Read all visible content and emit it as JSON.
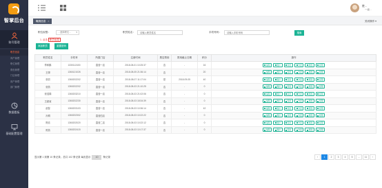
{
  "sidebar": {
    "logo_text": "智掌后台",
    "groups": [
      {
        "label": "账号管理",
        "icon": "user-icon",
        "active": true
      },
      {
        "label": "数据看板",
        "icon": "chart-icon",
        "active": false
      },
      {
        "label": "基础配置管理",
        "icon": "monitor-icon",
        "active": false
      }
    ],
    "sub_items": [
      "职员信息",
      "商户管理",
      "职位管理",
      "角色管理",
      "门店管理",
      "用户管理",
      "部门管理"
    ],
    "current_sub_index": 0
  },
  "topbar": {
    "user_name": "姓...",
    "user_role": "一级...",
    "menu_icon": "hamburger-icon",
    "grid_icon": "grid-icon"
  },
  "tabs": {
    "active_tab": "職員信息",
    "active_tab_close": "×",
    "close_ops": "关闭操作 ▾"
  },
  "filter": {
    "position_label": "职位权限：",
    "position_value": "- 选择职位 -",
    "name_label": "职员姓名：",
    "name_placeholder": "请输入职员姓名",
    "phone_label": "手机号码：",
    "phone_placeholder": "请输入手机号码",
    "search_button": "搜索",
    "hint_prefix": "1. 点击",
    "hint_boxed": "职员信息",
    "add_button": "添加职员",
    "reset_button": "重置密码"
  },
  "table": {
    "columns": [
      "职员姓名",
      "手机号",
      "所属门店",
      "注册时间",
      "是否禁用",
      "禁用截止日期",
      "积分",
      "操作"
    ],
    "rows": [
      [
        "李和鹏",
        "1330112400",
        "直营一店",
        "2018-08-01 10:25:37",
        "否",
        "-",
        "16"
      ],
      [
        "王嫦",
        "1360121026",
        "直营一店",
        "2018-08-05 21:36:14",
        "否",
        "-",
        "20"
      ],
      [
        "张初",
        "1360202202",
        "直营一店",
        "2018-08-07 11:17:04",
        "是",
        "2018-09-05",
        "40"
      ],
      [
        "张燕",
        "1360202202",
        "直营一店",
        "2018-08-03 21:10:25",
        "否",
        "-",
        "0"
      ],
      [
        "张浩娟",
        "1360203210",
        "直营一店",
        "2018-08-03 21:02:06",
        "否",
        "-",
        "0"
      ],
      [
        "王超淑",
        "1360202230",
        "直营一店",
        "2018-08-03 18:34:39",
        "否",
        "-",
        "0"
      ],
      [
        "赵智",
        "1360203103",
        "直营一店",
        "2018-08-03 10:36:14",
        "否",
        "-",
        "42"
      ],
      [
        "孙桐",
        "1360202302",
        "直营四店",
        "2018-08-03 10:22:22",
        "否",
        "-",
        "0"
      ],
      [
        "陈绩",
        "1360202020",
        "直营二店",
        "2018-08-03 10:22:12",
        "否",
        "-",
        "0"
      ],
      [
        "陈燕",
        "1360202415",
        "直营一店",
        "2018-08-03 10:17:37",
        "否",
        "-",
        "0"
      ]
    ],
    "ops": [
      "编辑",
      "账户",
      "积分",
      "卡密",
      "修改",
      "权限"
    ]
  },
  "footer": {
    "info_prefix": "显示第 1 到第 10 条记录，总共 102 条记录 每页显示",
    "page_size": "10",
    "info_suffix": "条记录",
    "pages": [
      "‹",
      "1",
      "2",
      "3",
      "4",
      "5",
      "...",
      "11",
      "›"
    ],
    "current_page": "1"
  }
}
